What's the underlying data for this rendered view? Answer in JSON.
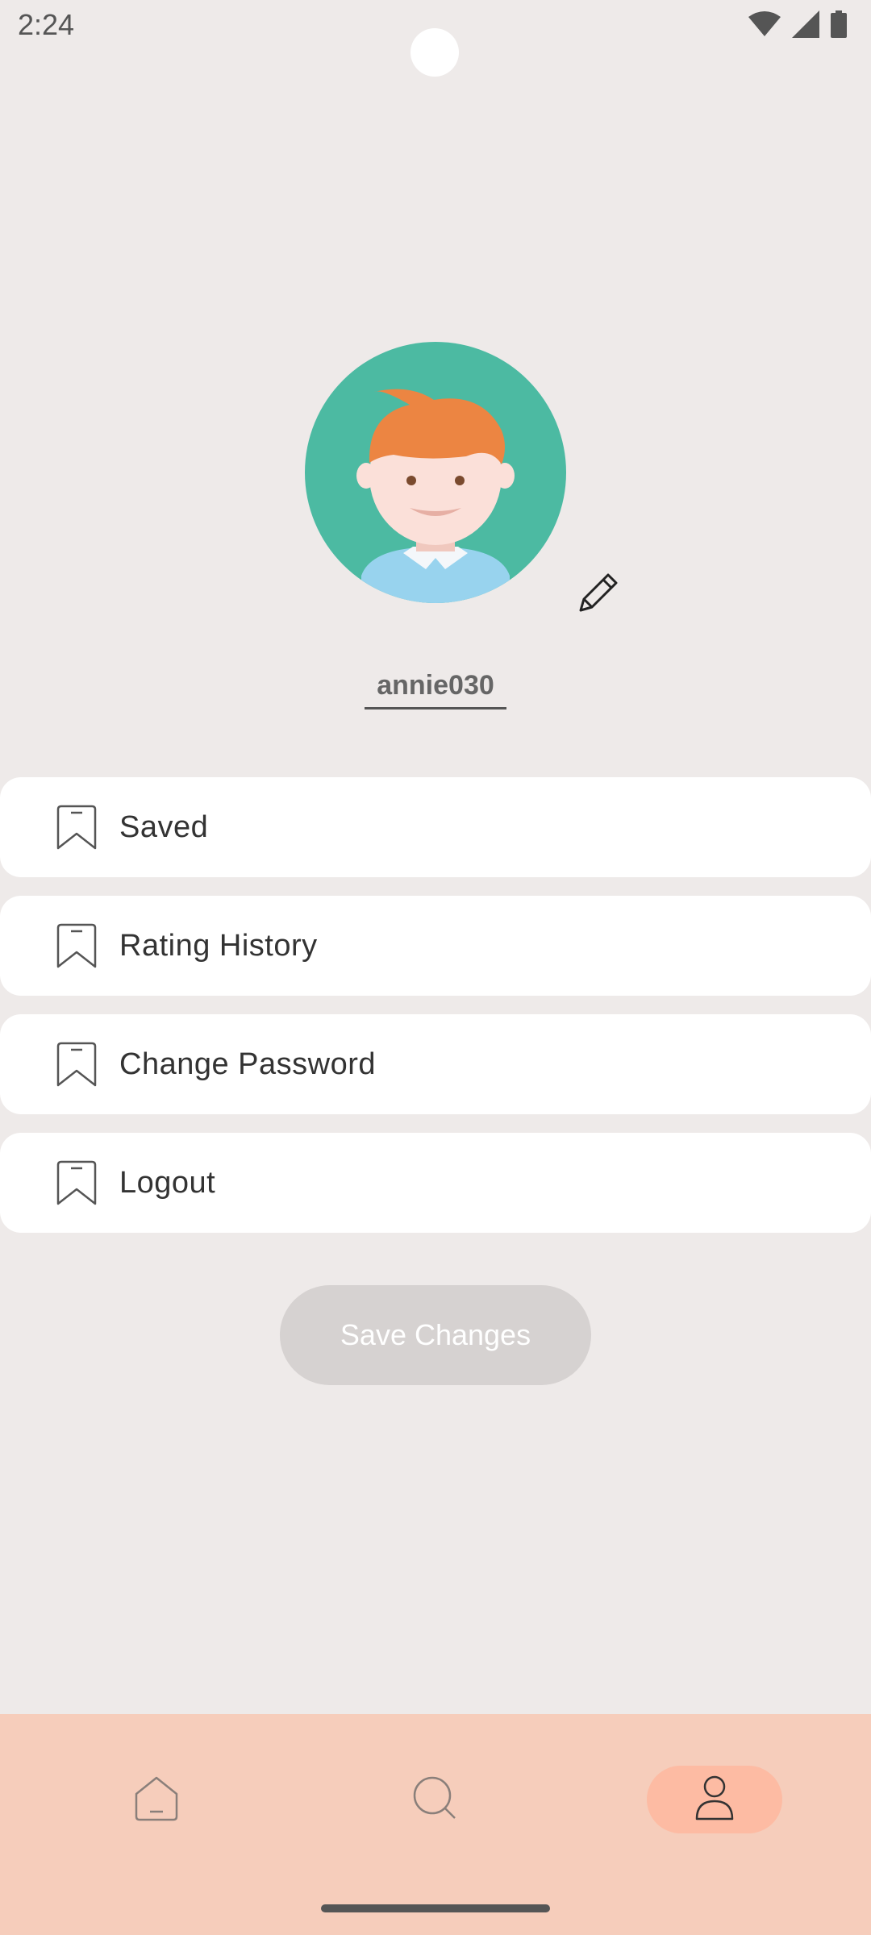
{
  "status_bar": {
    "time": "2:24",
    "icons": [
      "wifi-icon",
      "cellular-signal-icon",
      "battery-icon"
    ]
  },
  "profile": {
    "avatar": "avatar-illustration",
    "username": "annie030",
    "edit_icon": "pencil-icon"
  },
  "menu": {
    "items": [
      {
        "label": "Saved",
        "icon": "bookmark-icon"
      },
      {
        "label": "Rating History",
        "icon": "bookmark-icon"
      },
      {
        "label": "Change Password",
        "icon": "bookmark-icon"
      },
      {
        "label": "Logout",
        "icon": "bookmark-icon"
      }
    ]
  },
  "save_button": {
    "label": "Save Changes",
    "enabled": false
  },
  "bottom_nav": {
    "items": [
      {
        "icon": "home-icon",
        "active": false
      },
      {
        "icon": "search-icon",
        "active": false
      },
      {
        "icon": "profile-icon",
        "active": true
      }
    ]
  },
  "colors": {
    "background": "#EEEAE9",
    "card": "#FFFFFF",
    "nav_background": "#F6CDBB",
    "nav_active_pill": "#FDBBA3",
    "button_disabled": "#D6D2D1",
    "avatar_background": "#4CBAA2"
  }
}
